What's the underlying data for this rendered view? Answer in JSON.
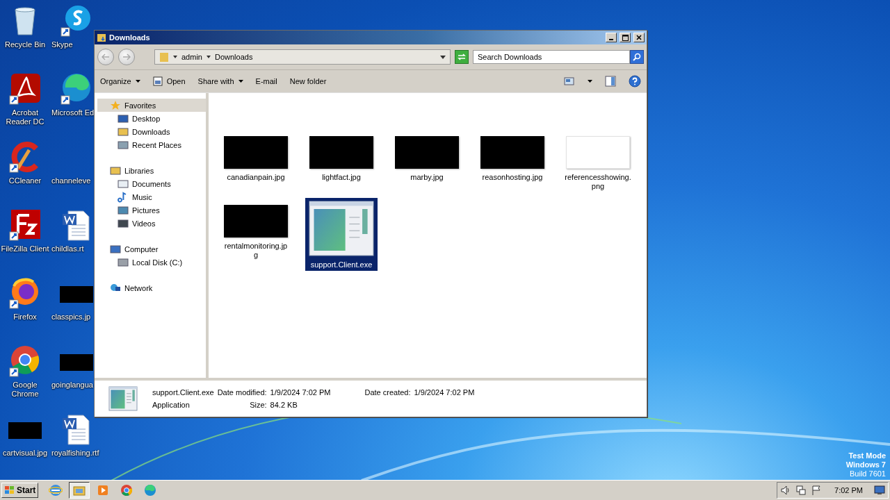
{
  "desktop": {
    "columns": [
      [
        {
          "label": "Recycle Bin",
          "kind": "recycle"
        },
        {
          "label": "Acrobat Reader DC",
          "kind": "acrobat"
        },
        {
          "label": "CCleaner",
          "kind": "ccleaner"
        },
        {
          "label": "FileZilla Client",
          "kind": "filezilla"
        },
        {
          "label": "Firefox",
          "kind": "firefox"
        },
        {
          "label": "Google Chrome",
          "kind": "chrome"
        },
        {
          "label": "cartvisual.jpg",
          "kind": "black"
        }
      ],
      [
        {
          "label": "Skype",
          "kind": "skype"
        },
        {
          "label": "Microsoft Ed",
          "kind": "edge"
        },
        {
          "label": "channeleve",
          "kind": "none"
        },
        {
          "label": "childlas.rt",
          "kind": "word"
        },
        {
          "label": "classpics.jp",
          "kind": "black"
        },
        {
          "label": "goinglangua",
          "kind": "black"
        },
        {
          "label": "royalfishing.rtf",
          "kind": "word"
        }
      ]
    ],
    "notice": [
      "Test Mode",
      "Windows 7",
      "Build 7601"
    ]
  },
  "window": {
    "title": "Downloads",
    "breadcrumb": [
      "admin",
      "Downloads"
    ],
    "search": {
      "placeholder": "Search Downloads"
    },
    "toolbar": [
      {
        "label": "Organize",
        "kind": "menu"
      },
      {
        "label": "Open",
        "kind": "open"
      },
      {
        "label": "Share with",
        "kind": "menu"
      },
      {
        "label": "E-mail",
        "kind": "plain"
      },
      {
        "label": "New folder",
        "kind": "plain"
      }
    ],
    "sidebar": [
      {
        "label": "Favorites",
        "kind": "star",
        "selected": true,
        "children": [
          {
            "label": "Desktop",
            "kind": "desktop",
            "selected": false
          },
          {
            "label": "Downloads",
            "kind": "folder",
            "selected": false
          },
          {
            "label": "Recent Places",
            "kind": "recent",
            "selected": false
          }
        ]
      },
      {
        "label": "Libraries",
        "kind": "libraries",
        "selected": false,
        "children": [
          {
            "label": "Documents",
            "kind": "document",
            "selected": false
          },
          {
            "label": "Music",
            "kind": "music",
            "selected": false
          },
          {
            "label": "Pictures",
            "kind": "pictures",
            "selected": false
          },
          {
            "label": "Videos",
            "kind": "videos",
            "selected": false
          }
        ]
      },
      {
        "label": "Computer",
        "kind": "computer",
        "selected": false,
        "children": [
          {
            "label": "Local Disk (C:)",
            "kind": "disk",
            "selected": false
          }
        ]
      },
      {
        "label": "Network",
        "kind": "network",
        "selected": false
      }
    ],
    "files": [
      {
        "name": "canadianpain.jpg",
        "kind": "black",
        "selected": false
      },
      {
        "name": "lightfact.jpg",
        "kind": "black",
        "selected": false
      },
      {
        "name": "marby.jpg",
        "kind": "black",
        "selected": false
      },
      {
        "name": "reasonhosting.jpg",
        "kind": "black",
        "selected": false
      },
      {
        "name": "referencesshowing.png",
        "kind": "white",
        "selected": false
      },
      {
        "name": "rentalmonitoring.jpg",
        "kind": "black",
        "selected": false
      },
      {
        "name": "support.Client.exe",
        "kind": "app",
        "selected": true
      }
    ],
    "details": {
      "name": "support.Client.exe",
      "type": "Application",
      "fields": [
        {
          "label": "Date modified:",
          "value": "1/9/2024 7:02 PM"
        },
        {
          "label": "Size:",
          "value": "84.2 KB"
        },
        {
          "label": "Date created:",
          "value": "1/9/2024 7:02 PM"
        }
      ]
    }
  },
  "taskbar": {
    "start": "Start",
    "apps": [
      {
        "kind": "ie",
        "selected": false
      },
      {
        "kind": "explorer",
        "selected": true
      },
      {
        "kind": "media",
        "selected": false
      },
      {
        "kind": "chrome",
        "selected": false
      },
      {
        "kind": "edge",
        "selected": false
      }
    ],
    "clock": "7:02 PM"
  }
}
